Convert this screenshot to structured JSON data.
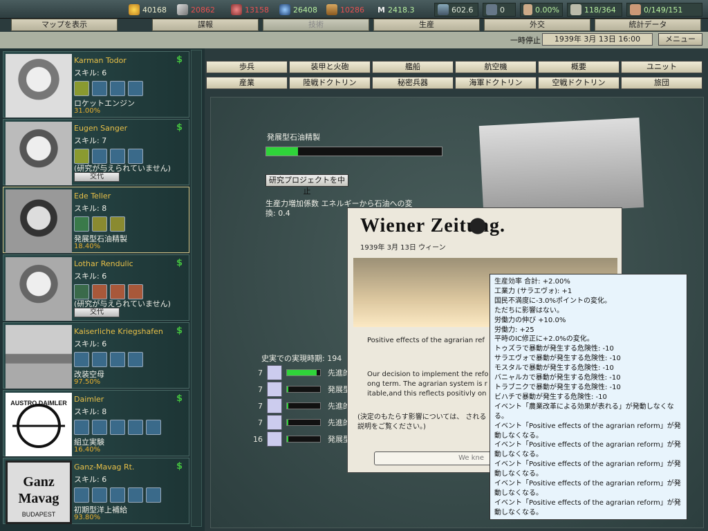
{
  "resources": [
    "40168",
    "20862",
    "13158",
    "26408",
    "10286",
    "2418.3",
    "602.6",
    "0",
    "0.00%",
    "118/364",
    "0/149/151"
  ],
  "tabs": [
    "マップを表示",
    "諜報",
    "技術",
    "生産",
    "外交",
    "統計データ"
  ],
  "datebar": {
    "pause": "一時停止",
    "date": "1939年 3月 13日 16:00",
    "menu": "メニュー"
  },
  "scientists": [
    {
      "name": "Karman Todor",
      "skill": "スキル: 6",
      "project": "ロケットエンジン",
      "progress": "31.00%"
    },
    {
      "name": "Eugen Sanger",
      "skill": "スキル: 7",
      "project": "(研究が与えられていません)",
      "button": "交代"
    },
    {
      "name": "Ede Teller",
      "skill": "スキル: 8",
      "project": "発展型石油精製",
      "progress": "18.40%"
    },
    {
      "name": "Lothar Rendulic",
      "skill": "スキル: 6",
      "project": "(研究が与えられていません)",
      "button": "交代"
    },
    {
      "name": "Kaiserliche Kriegshafen",
      "skill": "スキル: 6",
      "project": "改装空母",
      "progress": "97.50%"
    },
    {
      "name": "Daimler",
      "skill": "スキル: 8",
      "project": "組立実験",
      "progress": "16.40%",
      "logo_text": "AUSTRO DAIMLER"
    },
    {
      "name": "Ganz-Mavag Rt.",
      "skill": "スキル: 6",
      "project": "初期型洋上補給",
      "progress": "93.80%",
      "logo_line1": "Ganz",
      "logo_line2": "Mavag",
      "logo_line3": "BUDAPEST"
    }
  ],
  "categories": [
    "歩兵",
    "装甲と火砲",
    "艦船",
    "航空機",
    "概要",
    "ユニット",
    "産業",
    "陸戦ドクトリン",
    "秘密兵器",
    "海軍ドクトリン",
    "空戦ドクトリン",
    "旅団"
  ],
  "research": {
    "title": "発展型石油精製",
    "progress": 0.18,
    "cancel_button": "研究プロジェクトを中止",
    "effect": "生産力増加係数 エネルギーから石油への変換: 0.4",
    "historical_label": "史実での実現時期: 194",
    "rows": [
      {
        "num": "7",
        "label": "先進的",
        "progress": 0.9
      },
      {
        "num": "7",
        "label": "発展型",
        "progress": 0.05
      },
      {
        "num": "7",
        "label": "先進的",
        "progress": 0.05
      },
      {
        "num": "7",
        "label": "先進的",
        "progress": 0.05
      },
      {
        "num": "16",
        "label": "発展型",
        "progress": 0.05
      }
    ]
  },
  "newspaper": {
    "masthead": "Wiener Zeitung.",
    "dateline": "1939年 3月 13日 ウィーン",
    "headline": "Positive effects of the agrarian ref",
    "body": "Our decision to implement the refo ong term. The agrarian system is r itable,and this reflects positivly on",
    "note": "(決定のもたらす影響については、 される説明をご覧ください。)",
    "ok_button": "We kne"
  },
  "tooltip": [
    "生産効率 合計: +2.00%",
    "工業力 (サラエヴォ): +1",
    "国民不満度に-3.0%ポイントの変化。",
    "ただちに影響はない。",
    "労働力の伸び +10.0%",
    "労働力: +25",
    "平時のIC修正に+2.0%の変化。",
    "トゥズラで暴動が発生する危険性: -10",
    "サラエヴォで暴動が発生する危険性: -10",
    "モスタルで暴動が発生する危険性: -10",
    "バニャルカで暴動が発生する危険性: -10",
    "トラブニクで暴動が発生する危険性: -10",
    "ビハチで暴動が発生する危険性: -10",
    "イベント「農業改革による効果が表れる」が発動しなくなる。",
    "イベント「Positive effects of the agrarian reform」が発動しなくなる。",
    "イベント「Positive effects of the agrarian reform」が発動しなくなる。",
    "イベント「Positive effects of the agrarian reform」が発動しなくなる。",
    "イベント「Positive effects of the agrarian reform」が発動しなくなる。",
    "イベント「Positive effects of the agrarian reform」が発動しなくなる。"
  ]
}
